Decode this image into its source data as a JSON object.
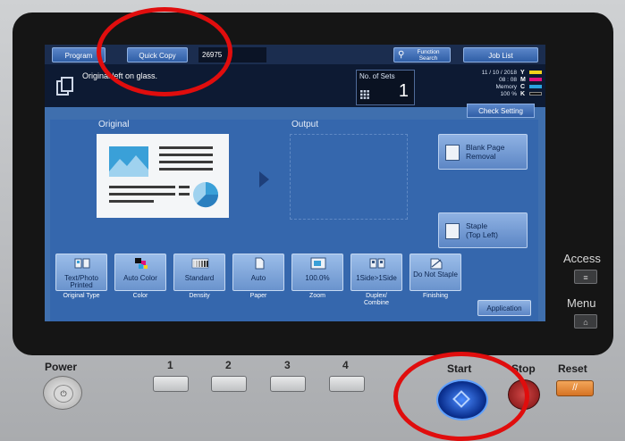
{
  "top_bar": {
    "program_label": "Program",
    "quick_copy_label": "Quick Copy",
    "field_value": "26975",
    "function_search_label": "Function Search",
    "job_list_label": "Job List"
  },
  "message": {
    "text": "Original left on glass."
  },
  "sets": {
    "label": "No. of Sets",
    "value": "1"
  },
  "status": {
    "date": "11 / 10 / 2018",
    "time": "08 : 08",
    "memory_label": "Memory",
    "memory_value": "100 %",
    "toner_letters": "Y\nM\nC\nK",
    "toner_colors": [
      "#f2d21b",
      "#e0117c",
      "#2aa3e0",
      "#111111"
    ]
  },
  "check_setting_label": "Check Setting",
  "labels": {
    "original": "Original",
    "output": "Output"
  },
  "side_buttons": {
    "blank_page": "Blank Page\nRemoval",
    "staple": "Staple\n(Top Left)"
  },
  "functions": [
    {
      "value": "Text/Photo Printed",
      "label": "Original Type",
      "icon": "book-icon"
    },
    {
      "value": "Auto Color",
      "label": "Color",
      "icon": "color-icon"
    },
    {
      "value": "Standard",
      "label": "Density",
      "icon": "density-icon"
    },
    {
      "value": "Auto",
      "label": "Paper",
      "icon": "paper-icon"
    },
    {
      "value": "100.0%",
      "label": "Zoom",
      "icon": "zoom-icon"
    },
    {
      "value": "1Side>1Side",
      "label": "Duplex/\nCombine",
      "icon": "duplex-icon"
    },
    {
      "value": "Do Not Staple",
      "label": "Finishing",
      "icon": "finishing-icon"
    }
  ],
  "application_label": "Application",
  "hardware": {
    "power_label": "Power",
    "numbers": [
      "1",
      "2",
      "3",
      "4"
    ],
    "start_label": "Start",
    "stop_label": "Stop",
    "reset_label": "Reset",
    "access_label": "Access",
    "menu_label": "Menu"
  },
  "annotation_color": "#e00d0d"
}
